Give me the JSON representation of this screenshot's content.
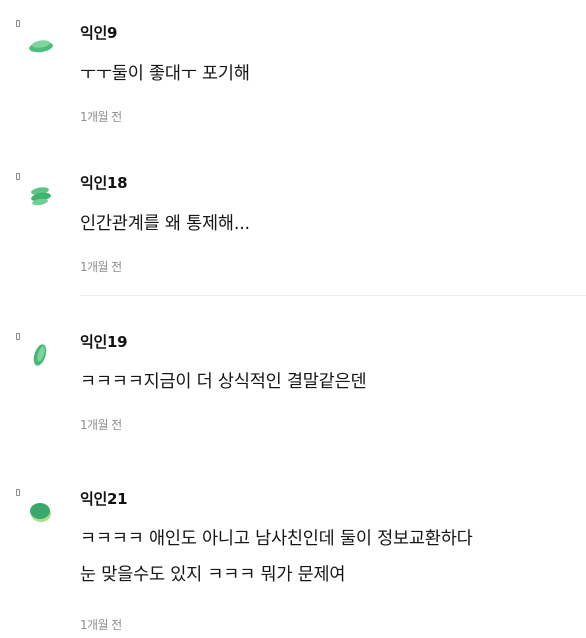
{
  "comments": [
    {
      "author": "익인9",
      "lines": [
        "ㅜㅜ둘이 좋대ㅜ 포기해"
      ],
      "time": "1개월 전",
      "avatar_icon": "leaf-avatar-icon",
      "avatar_color": "#4dbd7a"
    },
    {
      "author": "익인18",
      "lines": [
        "인간관계를 왜 통제해..."
      ],
      "time": "1개월 전",
      "avatar_icon": "leaf-avatar-icon",
      "avatar_color": "#3fb46e"
    },
    {
      "author": "익인19",
      "lines": [
        "ㅋㅋㅋㅋ지금이 더 상식적인 결말같은덴"
      ],
      "time": "1개월 전",
      "avatar_icon": "leaf-avatar-icon",
      "avatar_color": "#46b872"
    },
    {
      "author": "익인21",
      "lines": [
        "ㅋㅋㅋㅋ 애인도 아니고 남사친인데 둘이 정보교환하다",
        "눈 맞을수도 있지 ㅋㅋㅋ 뭐가 문제여"
      ],
      "time": "1개월 전",
      "avatar_icon": "leaf-avatar-icon",
      "avatar_color": "#3aa86a"
    }
  ]
}
